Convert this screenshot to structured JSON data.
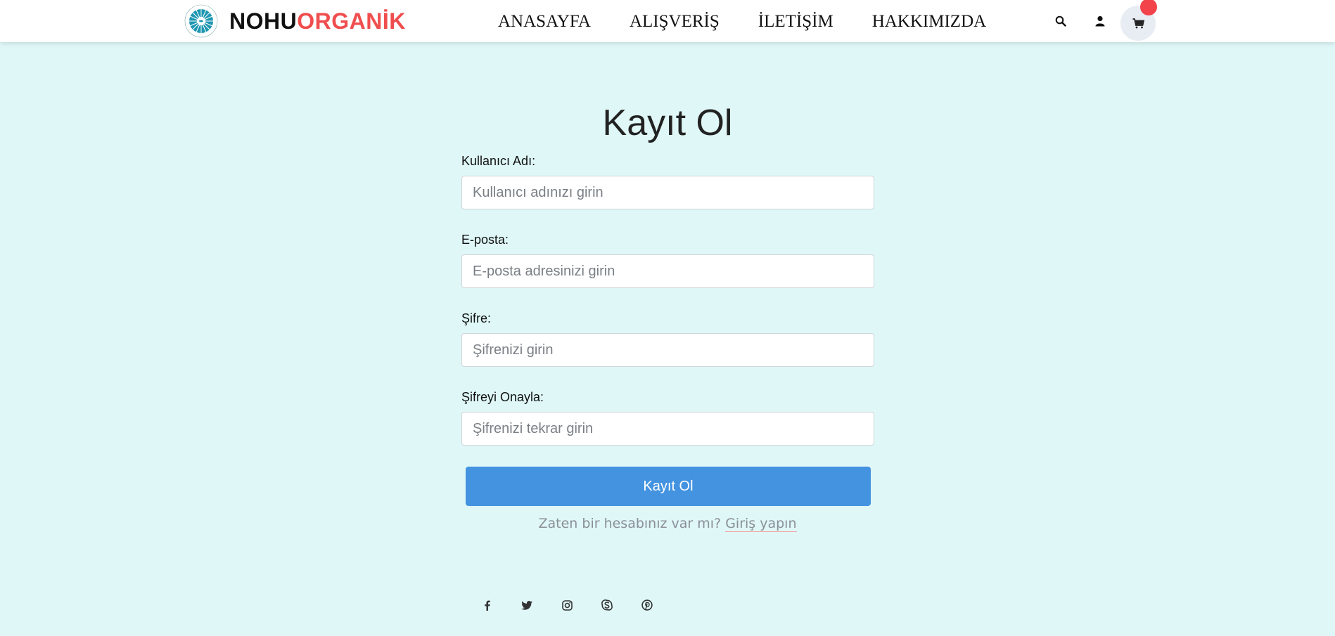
{
  "brand": {
    "part1": "NOHU",
    "part2": "ORGANİK",
    "emblem_icon": "logo-emblem"
  },
  "nav": {
    "items": [
      {
        "label": "ANASAYFA"
      },
      {
        "label": "ALIŞVERİŞ"
      },
      {
        "label": "İLETİŞİM"
      },
      {
        "label": "HAKKIMIZDA"
      }
    ]
  },
  "header_icons": [
    "search-icon",
    "user-icon",
    "cart-icon"
  ],
  "page": {
    "title": "Kayıt Ol"
  },
  "form": {
    "username": {
      "label": "Kullanıcı Adı:",
      "placeholder": "Kullanıcı adınızı girin",
      "value": ""
    },
    "email": {
      "label": "E-posta:",
      "placeholder": "E-posta adresinizi girin",
      "value": ""
    },
    "password": {
      "label": "Şifre:",
      "placeholder": "Şifrenizi girin",
      "value": ""
    },
    "confirm": {
      "label": "Şifreyi Onayla:",
      "placeholder": "Şifrenizi tekrar girin",
      "value": ""
    },
    "submit_label": "Kayıt Ol",
    "login_prompt": "Zaten bir hesabınız var mı?",
    "login_link": "Giriş yapın"
  },
  "social_icons": [
    "facebook-icon",
    "twitter-icon",
    "instagram-icon",
    "skype-icon",
    "pinterest-icon"
  ],
  "colors": {
    "background": "#dff7f7",
    "brand_accent": "#f04e4e",
    "button": "#4493e0",
    "badge": "#f2434a"
  }
}
